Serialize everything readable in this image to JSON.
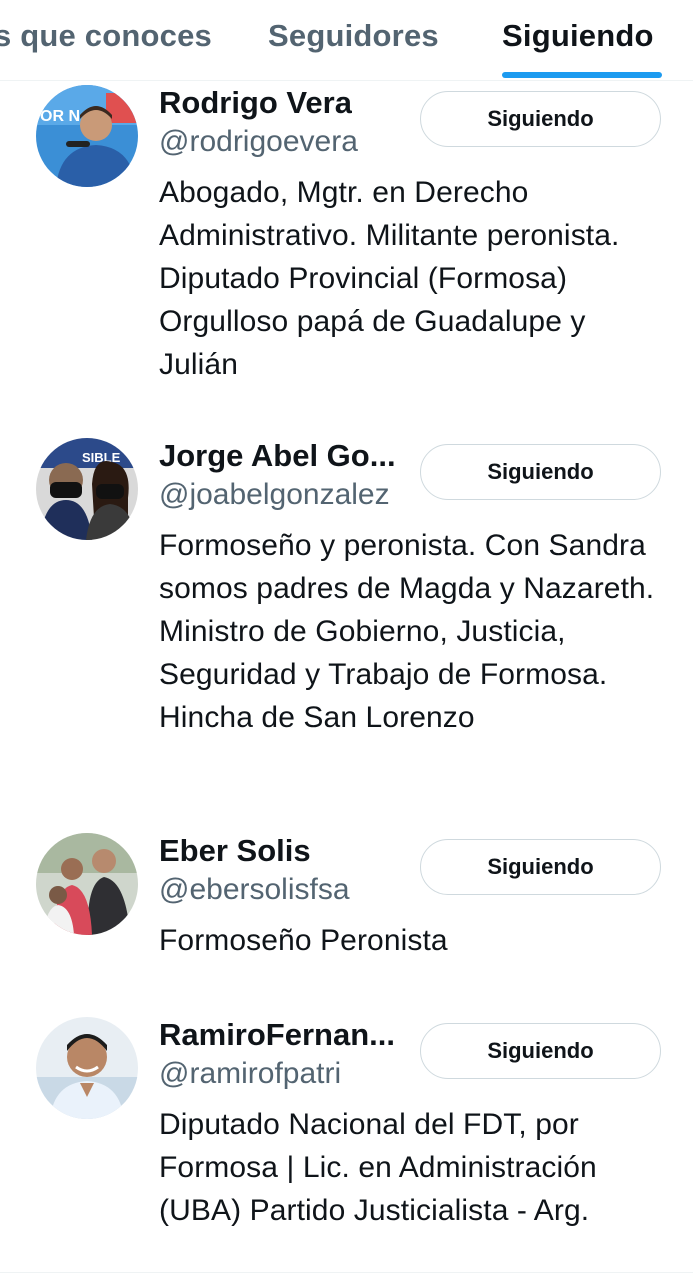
{
  "tabs": [
    {
      "label": "s que conoces",
      "active": false
    },
    {
      "label": "Seguidores",
      "active": false
    },
    {
      "label": "Siguiendo",
      "active": true
    }
  ],
  "accent_color": "#1d9bf0",
  "users": [
    {
      "name": "Rodrigo Vera",
      "handle": "@rodrigoevera",
      "button": "Siguiendo",
      "bio": "Abogado, Mgtr. en Derecho Administrativo. Militante peronista. Diputado Provincial (Formosa) Orgulloso papá de Guadalupe y Julián",
      "avatar": "avatar-photo"
    },
    {
      "name": "Jorge Abel Go...",
      "handle": "@joabelgonzalez",
      "button": "Siguiendo",
      "bio": "Formoseño y peronista. Con Sandra somos padres de Magda y Nazareth. Ministro de Gobierno, Justicia, Seguridad y Trabajo de Formosa. Hincha de San Lorenzo",
      "avatar": "avatar-photo"
    },
    {
      "name": "Eber Solis",
      "handle": "@ebersolisfsa",
      "button": "Siguiendo",
      "bio": "Formoseño Peronista",
      "avatar": "avatar-photo"
    },
    {
      "name": "RamiroFernan...",
      "handle": "@ramirofpatri",
      "button": "Siguiendo",
      "bio": "Diputado Nacional del FDT, por Formosa | Lic. en Administración (UBA) Partido Justicialista - Arg.",
      "avatar": "avatar-photo"
    }
  ]
}
